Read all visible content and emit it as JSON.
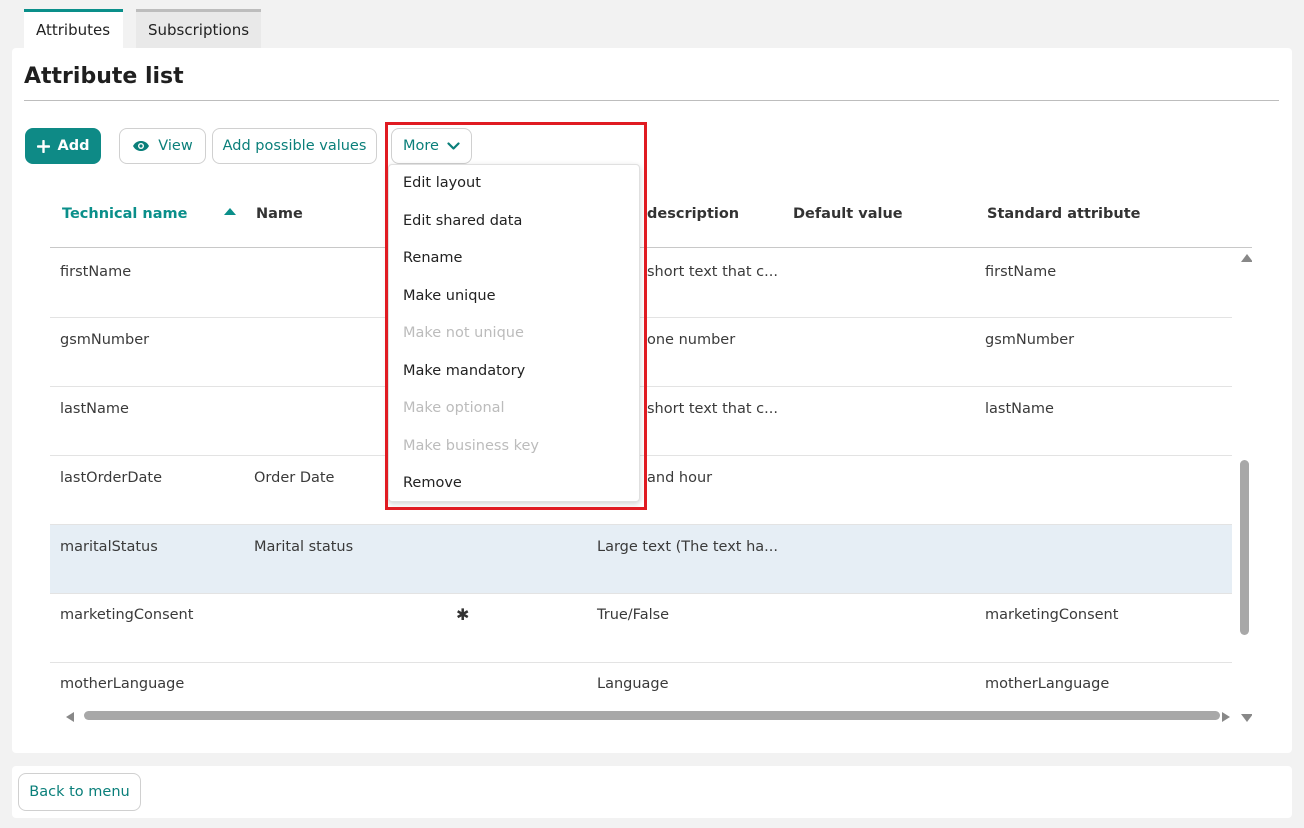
{
  "tabs": [
    {
      "label": "Attributes",
      "active": true
    },
    {
      "label": "Subscriptions",
      "active": false
    }
  ],
  "page_title": "Attribute list",
  "toolbar": {
    "add_label": "Add",
    "view_label": "View",
    "add_possible_values_label": "Add possible values",
    "more_label": "More"
  },
  "table": {
    "columns": {
      "technical_name": "Technical name",
      "name": "Name",
      "description": "description",
      "default_value": "Default value",
      "standard_attribute": "Standard attribute"
    },
    "sort": {
      "column": "technical_name",
      "direction": "ascending"
    },
    "rows": [
      {
        "technical_name": "firstName",
        "name": "",
        "mandatory": "",
        "description": "short text that c...",
        "default_value": "",
        "standard_attribute": "firstName",
        "selected": false
      },
      {
        "technical_name": "gsmNumber",
        "name": "",
        "mandatory": "",
        "description": "one number",
        "default_value": "",
        "standard_attribute": "gsmNumber",
        "selected": false
      },
      {
        "technical_name": "lastName",
        "name": "",
        "mandatory": "",
        "description": "short text that c...",
        "default_value": "",
        "standard_attribute": "lastName",
        "selected": false
      },
      {
        "technical_name": "lastOrderDate",
        "name": "Order Date",
        "mandatory": "",
        "description": "and hour",
        "default_value": "",
        "standard_attribute": "",
        "selected": false
      },
      {
        "technical_name": "maritalStatus",
        "name": "Marital status",
        "mandatory": "",
        "description": "Large text (The text ha...",
        "default_value": "",
        "standard_attribute": "",
        "selected": true
      },
      {
        "technical_name": "marketingConsent",
        "name": "",
        "mandatory": "✱",
        "description": "True/False",
        "default_value": "",
        "standard_attribute": "marketingConsent",
        "selected": false
      },
      {
        "technical_name": "motherLanguage",
        "name": "",
        "mandatory": "",
        "description": "Language",
        "default_value": "",
        "standard_attribute": "motherLanguage",
        "selected": false
      }
    ]
  },
  "more_menu": {
    "items": [
      {
        "label": "Edit layout",
        "enabled": true
      },
      {
        "label": "Edit shared data",
        "enabled": true
      },
      {
        "label": "Rename",
        "enabled": true
      },
      {
        "label": "Make unique",
        "enabled": true
      },
      {
        "label": "Make not unique",
        "enabled": false
      },
      {
        "label": "Make mandatory",
        "enabled": true
      },
      {
        "label": "Make optional",
        "enabled": false
      },
      {
        "label": "Make business key",
        "enabled": false
      },
      {
        "label": "Remove",
        "enabled": true
      }
    ]
  },
  "footer": {
    "back_label": "Back to menu"
  },
  "colors": {
    "accent": "#0e8a86",
    "highlight_border": "#e01b22",
    "selected_row": "#e6eef5"
  },
  "icons": {
    "add": "plus-icon",
    "view": "eye-icon",
    "more": "chevron-down-icon",
    "mandatory": "asterisk-icon"
  }
}
